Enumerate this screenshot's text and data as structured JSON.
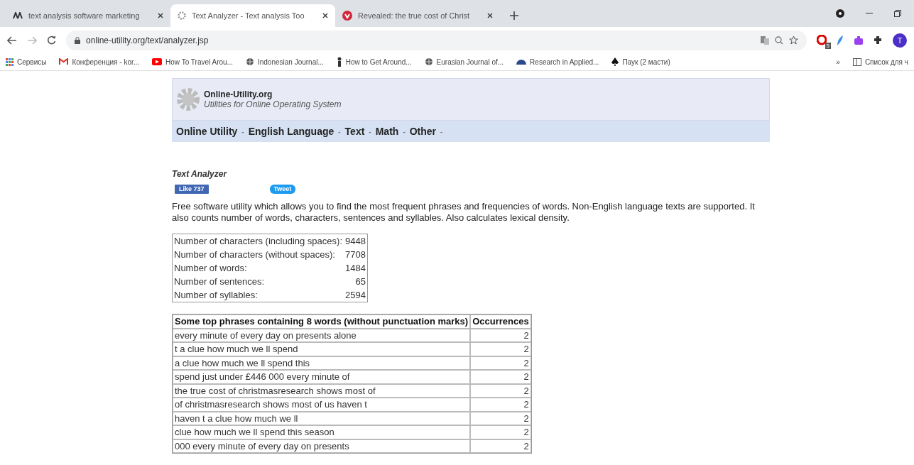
{
  "tabs": [
    {
      "label": "text analysis software marketing",
      "selected": false
    },
    {
      "label": "Text Analyzer - Text analysis Too",
      "selected": true
    },
    {
      "label": "Revealed: the true cost of Christ",
      "selected": false
    }
  ],
  "address": "online-utility.org/text/analyzer.jsp",
  "bookmarks": [
    {
      "label": "Сервисы"
    },
    {
      "label": "Конференция - kor..."
    },
    {
      "label": "How To Travel Arou..."
    },
    {
      "label": "Indonesian Journal..."
    },
    {
      "label": "How to Get Around..."
    },
    {
      "label": "Eurasian Journal of..."
    },
    {
      "label": "Research in Applied..."
    },
    {
      "label": "Паук (2 масти)"
    }
  ],
  "bookmarks_more": "»",
  "reading_list": "Список для ч",
  "extension_badge": "5",
  "profile_initial": "T",
  "site": {
    "name": "Online-Utility.org",
    "tagline": "Utilities for Online Operating System"
  },
  "nav": [
    {
      "label": "Online Utility",
      "caret": "-"
    },
    {
      "label": "English Language",
      "caret": "-"
    },
    {
      "label": "Text",
      "caret": "-"
    },
    {
      "label": "Math",
      "caret": "-"
    },
    {
      "label": "Other",
      "caret": "-"
    }
  ],
  "page_title": "Text Analyzer",
  "like_button": "Like 737",
  "tweet_button": "Tweet",
  "description": "Free software utility which allows you to find the most frequent phrases and frequencies of words. Non-English language texts are supported. It also counts number of words, characters, sentences and syllables. Also calculates lexical density.",
  "stats": [
    {
      "label": "Number of characters (including spaces):",
      "value": "9448"
    },
    {
      "label": "Number of characters (without spaces):",
      "value": "7708"
    },
    {
      "label": "Number of words:",
      "value": "1484"
    },
    {
      "label": "Number of sentences:",
      "value": "65"
    },
    {
      "label": "Number of syllables:",
      "value": "2594"
    }
  ],
  "phrases": {
    "columns": [
      "Some top phrases containing 8 words (without punctuation marks)",
      "Occurrences"
    ],
    "rows": [
      [
        "every minute of every day on presents alone",
        "2"
      ],
      [
        "t a clue how much we ll spend",
        "2"
      ],
      [
        "a clue how much we ll spend this",
        "2"
      ],
      [
        "spend just under £446 000 every minute of",
        "2"
      ],
      [
        "the true cost of christmasresearch shows most of",
        "2"
      ],
      [
        "of christmasresearch shows most of us haven t",
        "2"
      ],
      [
        "haven t a clue how much we ll",
        "2"
      ],
      [
        "clue how much we ll spend this season",
        "2"
      ],
      [
        "000 every minute of every day on presents",
        "2"
      ]
    ]
  }
}
